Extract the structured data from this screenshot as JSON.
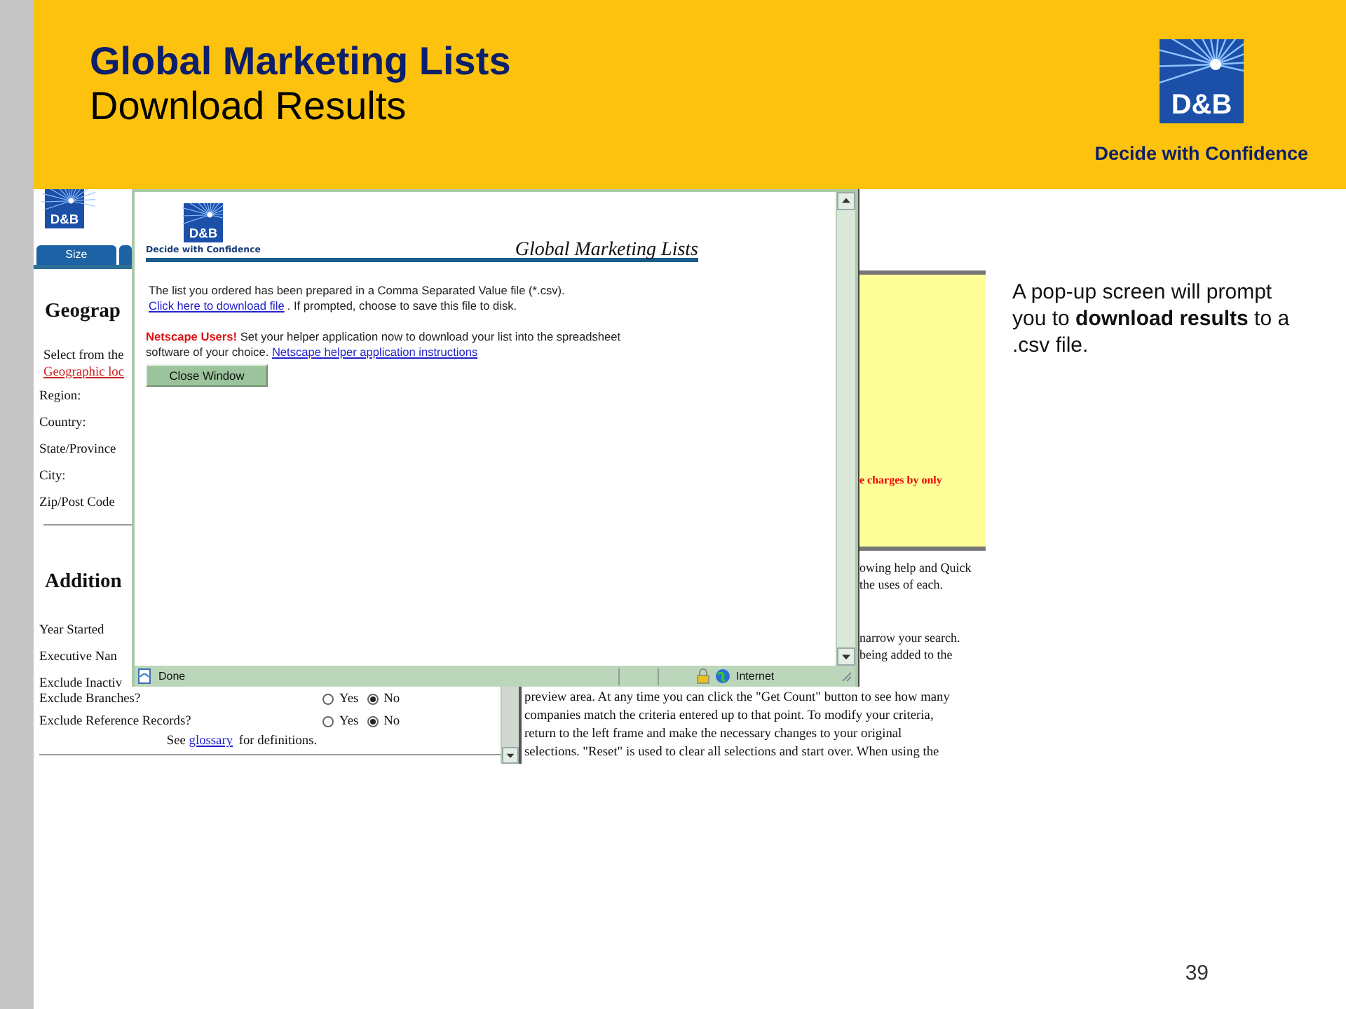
{
  "slide": {
    "title": "Global Marketing Lists",
    "subtitle": "Download Results",
    "logo": {
      "mark": "D&B",
      "tagline": "Decide with Confidence"
    },
    "note": "A pop-up screen will prompt you to **download results** to a .csv file.",
    "page_number": "39"
  },
  "screenshot": {
    "left_frame": {
      "logo": "D&B",
      "tabs": [
        {
          "label": "Size"
        },
        {
          "kind": "stub"
        }
      ],
      "heading_1": "Geograp",
      "intro": "Select from the",
      "link": "Geographic loc",
      "fields": [
        "Region:",
        "Country:",
        "State/Province",
        "City:",
        "Zip/Post Code"
      ],
      "heading_2": "Addition",
      "options": [
        "Year Started",
        "Executive Nan",
        "Exclude Inactiv"
      ],
      "radio_rows": [
        {
          "label": "Exclude Branches?",
          "choices": [
            {
              "label": "Yes",
              "selected": false
            },
            {
              "label": "No",
              "selected": true
            }
          ]
        },
        {
          "label": "Exclude Reference Records?",
          "choices": [
            {
              "label": "Yes",
              "selected": false
            },
            {
              "label": "No",
              "selected": true
            }
          ]
        }
      ],
      "footnote": {
        "before": "See",
        "link": "glossary",
        "after": "for definitions."
      }
    },
    "right_frame": {
      "notice": "e charges by only",
      "lines": [
        "owing help and Quick",
        "the uses of each."
      ],
      "lines_2": [
        "narrow your search.",
        "being added to the"
      ],
      "paragraph": [
        "preview area. At any time you can click the \"Get Count\" button to see how many",
        "companies match the criteria entered up to that point. To modify your criteria,",
        "return to the left frame and make the necessary changes to your original",
        "selections. \"Reset\" is used to clear all selections and start over. When using the"
      ]
    },
    "popup": {
      "logo": "D&B",
      "tagline": "Decide with Confidence",
      "title": "Global Marketing Lists",
      "message_1": {
        "text": "The list you ordered has been prepared in a Comma Separated Value file (*.csv).",
        "link": "Click here to download file",
        "after": ". If prompted, choose to save this file to disk."
      },
      "message_2": {
        "lines": [
          "**Netscape Users!** Set your helper application now to download your list into the spreadsheet",
          "software of your choice."
        ],
        "link": "Netscape helper application instructions"
      },
      "button": "Close Window",
      "status_bar": {
        "status": "Done",
        "zone": "Internet"
      }
    }
  }
}
